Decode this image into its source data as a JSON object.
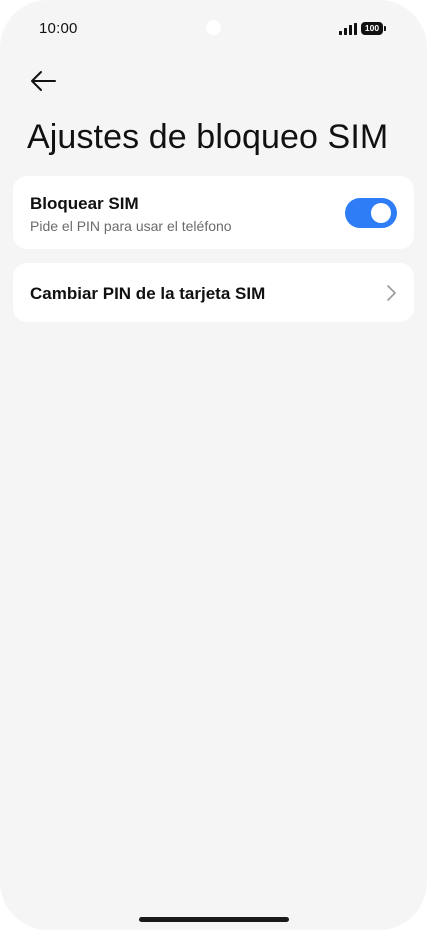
{
  "status_bar": {
    "time": "10:00",
    "battery_level": "100",
    "signal_icon": "signal-bars-icon"
  },
  "header": {
    "back_icon": "arrow-left-icon",
    "title": "Ajustes de bloqueo SIM"
  },
  "settings": {
    "lock_sim": {
      "title": "Bloquear SIM",
      "subtitle": "Pide el PIN para usar el teléfono",
      "enabled": true,
      "toggle_color": "#2f7df6"
    },
    "change_pin": {
      "label": "Cambiar PIN de la tarjeta SIM",
      "icon": "chevron-right-icon"
    }
  }
}
